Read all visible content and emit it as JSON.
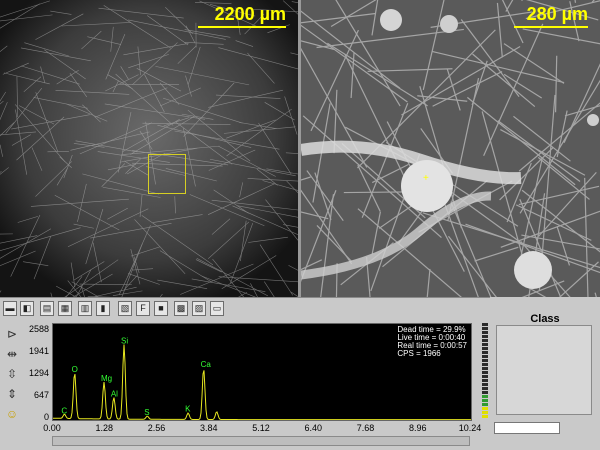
{
  "images": {
    "left": {
      "scale_label": "2200 µm"
    },
    "right": {
      "scale_label": "280 µm"
    }
  },
  "toolbar": {
    "buttons": [
      "save-icon",
      "open-icon",
      "print-preview-icon",
      "print-icon",
      "copy-icon",
      "marker-icon",
      "report-icon",
      "font-icon",
      "stop-icon",
      "grid-icon",
      "export-icon",
      "ruler-icon"
    ]
  },
  "spectrum": {
    "info": {
      "dead_time": "Dead time = 29.9%",
      "live_time": "Live time = 0:00:40",
      "real_time": "Real time = 0:00:57",
      "cps": "CPS = 1966"
    },
    "colors": {
      "trace": "#e8e820",
      "labels": "#33ff33",
      "background": "#000000"
    }
  },
  "chart_data": {
    "type": "line",
    "x_ticks": [
      "0.00",
      "1.28",
      "2.56",
      "3.84",
      "5.12",
      "6.40",
      "7.68",
      "8.96",
      "10.24"
    ],
    "y_ticks": [
      "2588",
      "1941",
      "1294",
      "647",
      "0"
    ],
    "xlim": [
      0,
      10.24
    ],
    "ylim": [
      0,
      2588
    ],
    "peaks": [
      {
        "label": "C",
        "x": 0.28,
        "y": 120
      },
      {
        "label": "O",
        "x": 0.53,
        "y": 1300
      },
      {
        "label": "Mg",
        "x": 1.25,
        "y": 1040
      },
      {
        "label": "Al",
        "x": 1.49,
        "y": 610
      },
      {
        "label": "Si",
        "x": 1.74,
        "y": 2100
      },
      {
        "label": "S",
        "x": 2.31,
        "y": 90
      },
      {
        "label": "K",
        "x": 3.31,
        "y": 180
      },
      {
        "label": "Ca",
        "x": 3.69,
        "y": 1440
      },
      {
        "label": "",
        "x": 4.01,
        "y": 220
      }
    ]
  },
  "class_panel": {
    "title": "Class"
  }
}
